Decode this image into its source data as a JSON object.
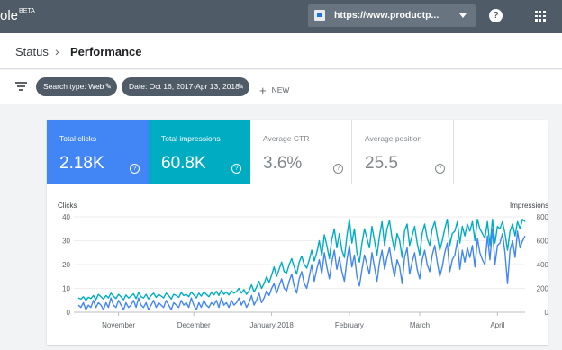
{
  "app": {
    "logo": "ole",
    "badge": "BETA"
  },
  "property": {
    "url": "https://www.productp..."
  },
  "icons": {
    "help": "help-icon",
    "apps": "apps-grid-icon",
    "filter": "filter-icon",
    "edit": "pencil-icon",
    "add": "plus-icon",
    "caret": "caret-down-icon",
    "property": "property-icon"
  },
  "breadcrumb": {
    "parent": "Status",
    "separator": "›",
    "current": "Performance"
  },
  "filters": {
    "chips": [
      {
        "label": "Search type: Web"
      },
      {
        "label": "Date: Oct 16, 2017-Apr 13, 2018"
      }
    ],
    "new_label": "NEW"
  },
  "metrics": [
    {
      "label": "Total clicks",
      "value": "2.18K",
      "help": "?"
    },
    {
      "label": "Total impressions",
      "value": "60.8K",
      "help": "?"
    },
    {
      "label": "Average CTR",
      "value": "3.6%",
      "help": "?"
    },
    {
      "label": "Average position",
      "value": "25.5",
      "help": "?"
    }
  ],
  "colors": {
    "topbar": "#4f5b66",
    "clicks": "#4285f4",
    "impressions": "#00acc1"
  },
  "chart_data": {
    "type": "line",
    "left_axis_label": "Clicks",
    "right_axis_label": "Impressions",
    "left_ylim": [
      0,
      40
    ],
    "right_ylim": [
      0,
      800
    ],
    "left_ticks": [
      "0",
      "10",
      "20",
      "30",
      "40"
    ],
    "right_ticks": [
      "0",
      "200",
      "400",
      "600",
      "800"
    ],
    "x_labels": [
      "November",
      "December",
      "January 2018",
      "February",
      "March",
      "April"
    ],
    "x_label_days": [
      16,
      46,
      77,
      108,
      136,
      167
    ],
    "grid": true,
    "series": [
      {
        "name": "Clicks",
        "axis": "left",
        "values": [
          3,
          2,
          4,
          1,
          3,
          2,
          5,
          2,
          4,
          3,
          1,
          4,
          2,
          6,
          3,
          2,
          5,
          3,
          1,
          4,
          2,
          3,
          5,
          2,
          6,
          3,
          2,
          4,
          1,
          3,
          5,
          2,
          4,
          3,
          2,
          5,
          3,
          1,
          4,
          3,
          2,
          5,
          3,
          4,
          2,
          6,
          3,
          1,
          4,
          2,
          5,
          3,
          2,
          4,
          3,
          5,
          2,
          6,
          3,
          4,
          2,
          5,
          3,
          4,
          6,
          3,
          5,
          2,
          4,
          7,
          3,
          5,
          8,
          4,
          6,
          9,
          7,
          10,
          12,
          8,
          11,
          14,
          10,
          9,
          13,
          16,
          11,
          8,
          14,
          17,
          12,
          10,
          15,
          20,
          13,
          18,
          22,
          16,
          25,
          19,
          14,
          21,
          26,
          18,
          23,
          17,
          13,
          22,
          28,
          19,
          24,
          15,
          11,
          18,
          24,
          20,
          16,
          25,
          19,
          13,
          21,
          26,
          18,
          23,
          27,
          20,
          15,
          22,
          19,
          12,
          23,
          27,
          16,
          21,
          25,
          18,
          14,
          22,
          26,
          20,
          17,
          24,
          28,
          21,
          15,
          19,
          25,
          29,
          17,
          22,
          24,
          30,
          18,
          26,
          21,
          27,
          23,
          28,
          19,
          31,
          25,
          22,
          20,
          32,
          22,
          35,
          20,
          28,
          29,
          33,
          25,
          12,
          26,
          30,
          23,
          34,
          27,
          30,
          32
        ]
      },
      {
        "name": "Impressions",
        "axis": "right",
        "values": [
          120,
          110,
          130,
          100,
          125,
          115,
          140,
          105,
          150,
          130,
          110,
          140,
          120,
          160,
          135,
          115,
          150,
          130,
          105,
          145,
          120,
          135,
          155,
          115,
          165,
          130,
          120,
          150,
          110,
          140,
          160,
          125,
          150,
          135,
          120,
          160,
          140,
          110,
          150,
          140,
          125,
          165,
          140,
          150,
          130,
          170,
          145,
          120,
          160,
          135,
          170,
          150,
          130,
          165,
          145,
          175,
          140,
          185,
          150,
          170,
          145,
          180,
          160,
          175,
          200,
          160,
          190,
          150,
          180,
          230,
          170,
          210,
          260,
          200,
          240,
          300,
          250,
          310,
          380,
          300,
          360,
          420,
          340,
          330,
          400,
          450,
          380,
          320,
          420,
          470,
          400,
          370,
          440,
          520,
          430,
          500,
          600,
          470,
          650,
          560,
          450,
          610,
          700,
          540,
          660,
          520,
          460,
          640,
          780,
          580,
          700,
          500,
          420,
          580,
          700,
          620,
          540,
          720,
          600,
          480,
          640,
          760,
          560,
          700,
          770,
          620,
          520,
          660,
          600,
          460,
          680,
          740,
          560,
          640,
          720,
          580,
          480,
          660,
          740,
          620,
          560,
          700,
          760,
          640,
          520,
          600,
          700,
          780,
          560,
          660,
          680,
          760,
          580,
          720,
          640,
          740,
          680,
          760,
          600,
          780,
          700,
          660,
          620,
          760,
          560,
          780,
          580,
          720,
          700,
          760,
          660,
          520,
          680,
          740,
          640,
          760,
          700,
          780,
          760
        ]
      }
    ]
  }
}
